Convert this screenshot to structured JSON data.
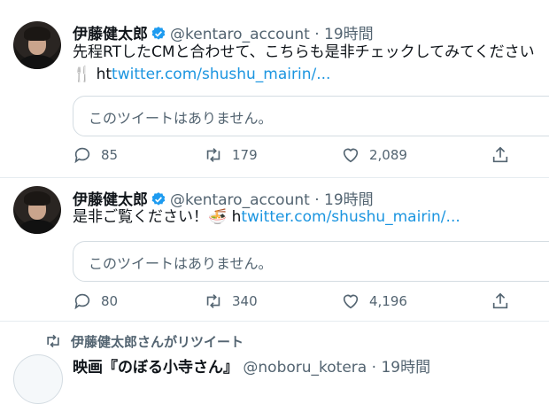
{
  "tweets": [
    {
      "name": "伊藤健太郎",
      "handle": "@kentaro_account",
      "dot": "·",
      "time": "19時間",
      "line1": "先程RTしたCMと合わせて、こちらも是非チェックしてみてください",
      "emoji": "🍴",
      "link_prefix": "ht",
      "link": "twitter.com/shushu_mairin/...",
      "quote": "このツイートはありません。",
      "replies": "85",
      "retweets": "179",
      "likes": "2,089"
    },
    {
      "name": "伊藤健太郎",
      "handle": "@kentaro_account",
      "dot": "·",
      "time": "19時間",
      "line1": "是非ご覧ください！",
      "emoji": "🍜",
      "link_prefix": "h",
      "link": "twitter.com/shushu_mairin/...",
      "quote": "このツイートはありません。",
      "replies": "80",
      "retweets": "340",
      "likes": "4,196"
    }
  ],
  "retweet_notice": "伊藤健太郎さんがリツイート",
  "partial_tweet": {
    "name": "映画『のぼる小寺さん』",
    "handle": "@noboru_kotera",
    "dot": "·",
    "time": "19時間"
  },
  "colors": {
    "link": "#1b95e0",
    "verified": "#1d9bf0",
    "muted": "#536471"
  }
}
